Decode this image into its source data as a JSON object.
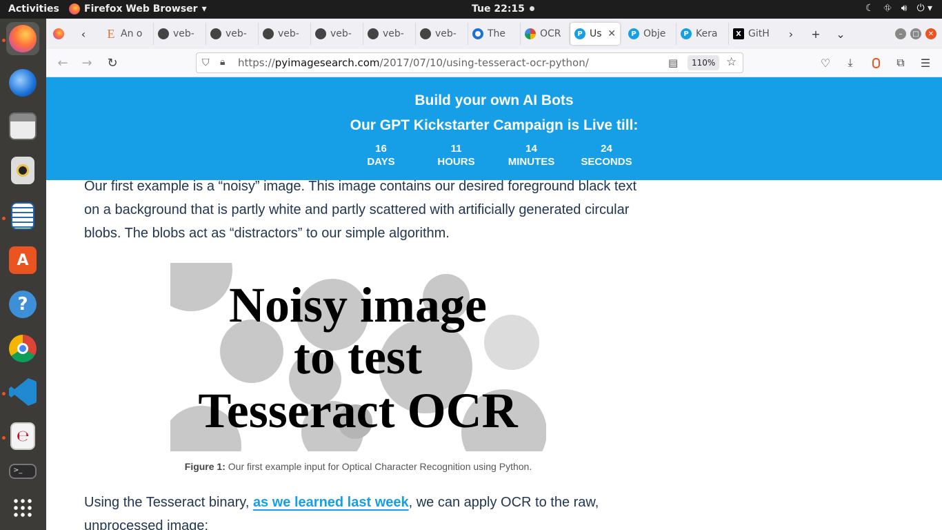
{
  "topbar": {
    "activities": "Activities",
    "app_name": "Firefox Web Browser",
    "clock": "Tue 22:15"
  },
  "dock": {
    "items": [
      "firefox",
      "thunderbird",
      "files",
      "rhythmbox",
      "libreoffice-writer",
      "app-center",
      "help",
      "chrome",
      "vscode",
      "text-editor",
      "terminal",
      "show-apps"
    ]
  },
  "tabs": [
    {
      "label": "An o",
      "icon": "E",
      "color": "#e0702f"
    },
    {
      "label": "veb-",
      "icon": "github-icon",
      "color": "#333333"
    },
    {
      "label": "veb-",
      "icon": "github-icon",
      "color": "#333333"
    },
    {
      "label": "veb-",
      "icon": "github-icon",
      "color": "#333333"
    },
    {
      "label": "veb-",
      "icon": "github-icon",
      "color": "#333333"
    },
    {
      "label": "veb-",
      "icon": "github-icon",
      "color": "#333333"
    },
    {
      "label": "veb-",
      "icon": "github-icon",
      "color": "#333333"
    },
    {
      "label": "The",
      "icon": "circle-icon",
      "color": "#1e6fd9"
    },
    {
      "label": "OCR",
      "icon": "google-icon",
      "color": "#db4437"
    },
    {
      "label": "Us",
      "icon": "P",
      "color": "#169fe6",
      "selected": true
    },
    {
      "label": "Obje",
      "icon": "P",
      "color": "#169fe6"
    },
    {
      "label": "Kera",
      "icon": "P",
      "color": "#169fe6"
    },
    {
      "label": "GitH",
      "icon": "X",
      "color": "#000000"
    }
  ],
  "url": {
    "prefix": "https://",
    "host": "pyimagesearch.com",
    "path": "/2017/07/10/using-tesseract-ocr-python/",
    "zoom": "110%"
  },
  "banner": {
    "line1": "Build your own AI Bots",
    "line2": "Our GPT Kickstarter Campaign is Live till:",
    "countdown": [
      {
        "value": "16",
        "unit": "DAYS"
      },
      {
        "value": "11",
        "unit": "HOURS"
      },
      {
        "value": "14",
        "unit": "MINUTES"
      },
      {
        "value": "24",
        "unit": "SECONDS"
      }
    ]
  },
  "article": {
    "p1": "Our first example is a “noisy” image. This image contains our desired foreground black text on a background that is partly white and partly scattered with artificially generated circular blobs. The blobs act as “distractors” to our simple algorithm.",
    "figure_text": [
      "Noisy image",
      "to test",
      "Tesseract OCR"
    ],
    "caption_label": "Figure 1:",
    "caption_text": " Our first example input for Optical Character Recognition using Python.",
    "p2_before": "Using the Tesseract binary, ",
    "p2_link": "as we learned last week",
    "p2_after": ", we can apply OCR to the raw, unprocessed image:"
  }
}
